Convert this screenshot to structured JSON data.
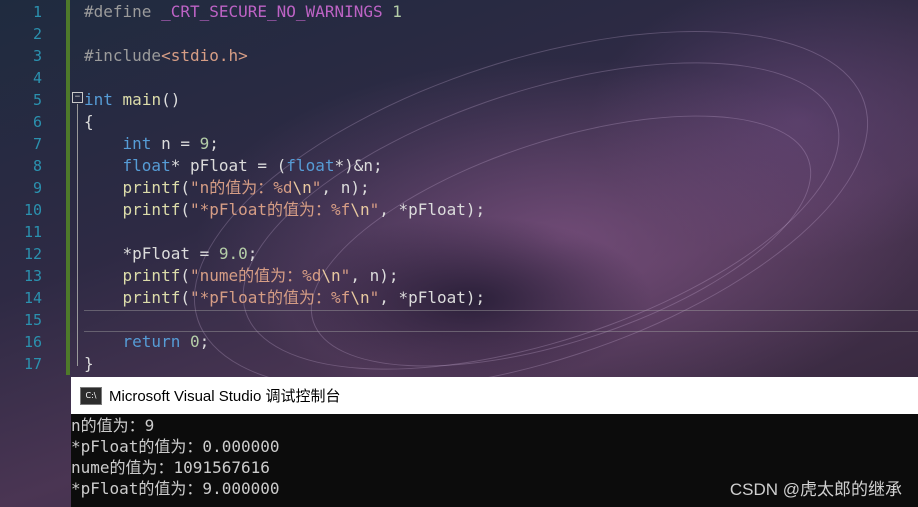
{
  "editor": {
    "line_numbers": [
      "1",
      "2",
      "3",
      "4",
      "5",
      "6",
      "7",
      "8",
      "9",
      "10",
      "11",
      "12",
      "13",
      "14",
      "15",
      "16",
      "17"
    ],
    "lines": [
      {
        "parts": [
          {
            "t": "#define ",
            "c": "pp"
          },
          {
            "t": "_CRT_SECURE_NO_WARNINGS",
            "c": "macro"
          },
          {
            "t": " 1",
            "c": "num"
          }
        ]
      },
      {
        "parts": []
      },
      {
        "parts": [
          {
            "t": "#include",
            "c": "pp"
          },
          {
            "t": "<stdio.h>",
            "c": "str"
          }
        ]
      },
      {
        "parts": []
      },
      {
        "parts": [
          {
            "t": "int",
            "c": "kw"
          },
          {
            "t": " "
          },
          {
            "t": "main",
            "c": "fn"
          },
          {
            "t": "()"
          }
        ]
      },
      {
        "parts": [
          {
            "t": "{"
          }
        ]
      },
      {
        "parts": [
          {
            "t": "    "
          },
          {
            "t": "int",
            "c": "kw"
          },
          {
            "t": " n = "
          },
          {
            "t": "9",
            "c": "num"
          },
          {
            "t": ";"
          }
        ]
      },
      {
        "parts": [
          {
            "t": "    "
          },
          {
            "t": "float",
            "c": "kw"
          },
          {
            "t": "* pFloat = ("
          },
          {
            "t": "float",
            "c": "kw"
          },
          {
            "t": "*)&n;"
          }
        ]
      },
      {
        "parts": [
          {
            "t": "    "
          },
          {
            "t": "printf",
            "c": "fn"
          },
          {
            "t": "("
          },
          {
            "t": "\"n的值为：%d",
            "c": "str"
          },
          {
            "t": "\\n",
            "c": "esc"
          },
          {
            "t": "\"",
            "c": "str"
          },
          {
            "t": ", n);"
          }
        ]
      },
      {
        "parts": [
          {
            "t": "    "
          },
          {
            "t": "printf",
            "c": "fn"
          },
          {
            "t": "("
          },
          {
            "t": "\"*pFloat的值为：%f",
            "c": "str"
          },
          {
            "t": "\\n",
            "c": "esc"
          },
          {
            "t": "\"",
            "c": "str"
          },
          {
            "t": ", *pFloat);"
          }
        ]
      },
      {
        "parts": []
      },
      {
        "parts": [
          {
            "t": "    *pFloat = "
          },
          {
            "t": "9.0",
            "c": "num"
          },
          {
            "t": ";"
          }
        ]
      },
      {
        "parts": [
          {
            "t": "    "
          },
          {
            "t": "printf",
            "c": "fn"
          },
          {
            "t": "("
          },
          {
            "t": "\"nume的值为：%d",
            "c": "str"
          },
          {
            "t": "\\n",
            "c": "esc"
          },
          {
            "t": "\"",
            "c": "str"
          },
          {
            "t": ", n);"
          }
        ]
      },
      {
        "parts": [
          {
            "t": "    "
          },
          {
            "t": "printf",
            "c": "fn"
          },
          {
            "t": "("
          },
          {
            "t": "\"*pFloat的值为：%f",
            "c": "str"
          },
          {
            "t": "\\n",
            "c": "esc"
          },
          {
            "t": "\"",
            "c": "str"
          },
          {
            "t": ", *pFloat);"
          }
        ]
      },
      {
        "parts": []
      },
      {
        "parts": [
          {
            "t": "    "
          },
          {
            "t": "return",
            "c": "kw"
          },
          {
            "t": " "
          },
          {
            "t": "0",
            "c": "num"
          },
          {
            "t": ";"
          }
        ]
      },
      {
        "parts": [
          {
            "t": "}"
          }
        ]
      }
    ],
    "fold_symbol": "−"
  },
  "console": {
    "icon_text": "C:\\",
    "title": "Microsoft Visual Studio 调试控制台",
    "output": [
      "n的值为：9",
      "*pFloat的值为：0.000000",
      "nume的值为：1091567616",
      "*pFloat的值为：9.000000"
    ]
  },
  "watermark": "CSDN @虎太郎的继承",
  "colors": {
    "keyword": "#569cd6",
    "function": "#dcdcaa",
    "string": "#d69d85",
    "number": "#b5cea8",
    "macro": "#bd63c5",
    "line_number": "#2b91af",
    "console_bg": "#0c0c0c"
  }
}
